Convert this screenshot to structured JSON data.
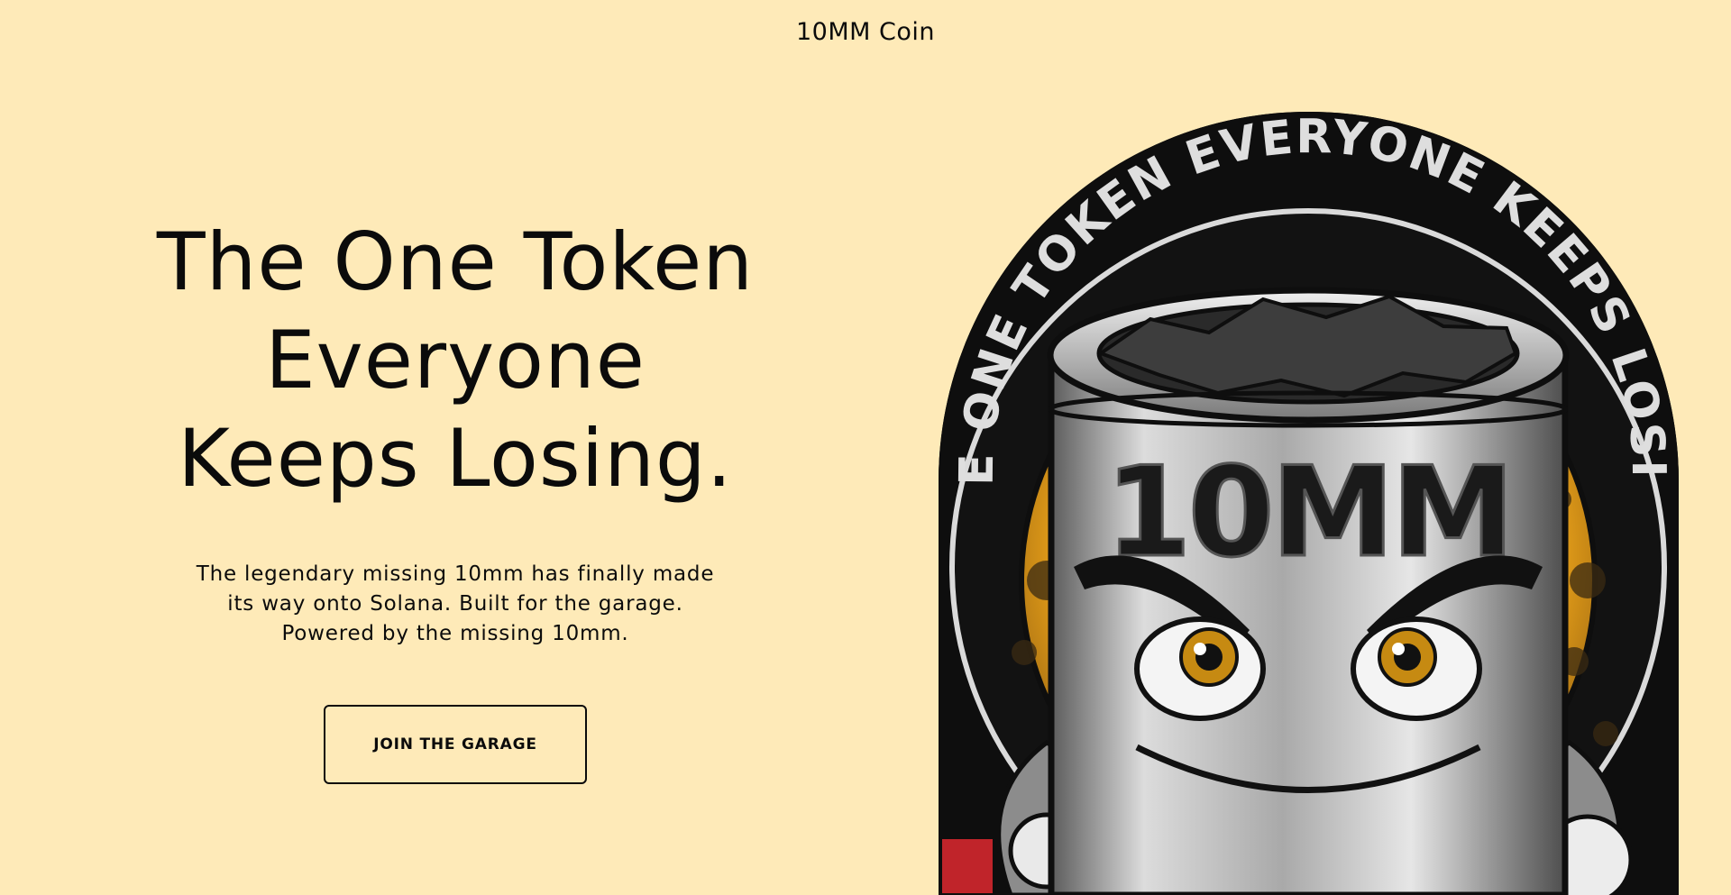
{
  "header": {
    "site_title": "10MM Coin"
  },
  "hero": {
    "headline_lines": [
      "The One Token",
      "Everyone",
      "Keeps Losing."
    ],
    "subtitle_lines": [
      "The legendary missing 10mm has finally made",
      "its way onto Solana. Built for the garage.",
      "Powered by the missing 10mm."
    ],
    "cta_label": "JOIN THE GARAGE"
  },
  "artwork": {
    "arc_text": "THE ONE TOKEN EVERYONE KEEPS LOSING",
    "socket_label": "10MM",
    "colors": {
      "background": "#feeab8",
      "ring": "#f2ab1c",
      "steel": "#b9b9b9",
      "outline": "#0e0e0e"
    }
  }
}
